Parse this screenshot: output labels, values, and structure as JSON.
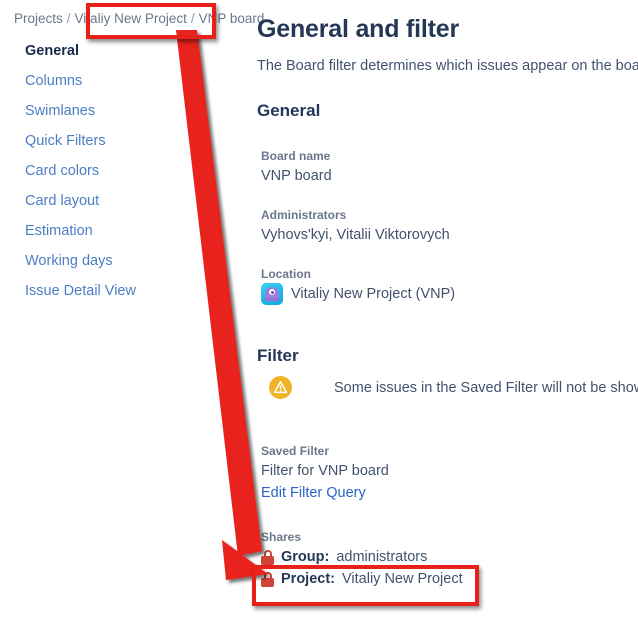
{
  "breadcrumb": {
    "items": [
      {
        "label": "Projects"
      },
      {
        "label": "Vitaliy New Project"
      },
      {
        "label": "VNP board"
      }
    ],
    "separator": "/"
  },
  "sidebar": {
    "items": [
      {
        "label": "General",
        "selected": true
      },
      {
        "label": "Columns",
        "selected": false
      },
      {
        "label": "Swimlanes",
        "selected": false
      },
      {
        "label": "Quick Filters",
        "selected": false
      },
      {
        "label": "Card colors",
        "selected": false
      },
      {
        "label": "Card layout",
        "selected": false
      },
      {
        "label": "Estimation",
        "selected": false
      },
      {
        "label": "Working days",
        "selected": false
      },
      {
        "label": "Issue Detail View",
        "selected": false
      }
    ]
  },
  "main": {
    "title": "General and filter",
    "description": "The Board filter determines which issues appear on the board.",
    "general": {
      "heading": "General",
      "board_name_label": "Board name",
      "board_name_value": "VNP board",
      "administrators_label": "Administrators",
      "administrators_value": "Vyhovs'kyi, Vitalii Viktorovych",
      "location_label": "Location",
      "location_value": "Vitaliy New Project (VNP)"
    },
    "filter": {
      "heading": "Filter",
      "warning_text": "Some issues in the Saved Filter will not be shown on",
      "saved_filter_label": "Saved Filter",
      "saved_filter_value": "Filter for VNP board",
      "edit_filter_query_link": "Edit Filter Query",
      "shares_label": "Shares",
      "shares": [
        {
          "key": "Group:",
          "value": "administrators"
        },
        {
          "key": "Project:",
          "value": "Vitaliy New Project"
        }
      ]
    }
  },
  "annotation": {
    "color": "#e8201a",
    "highlight_breadcrumb": "Vitaliy New Project",
    "highlight_share": "Project: Vitaliy New Project"
  }
}
